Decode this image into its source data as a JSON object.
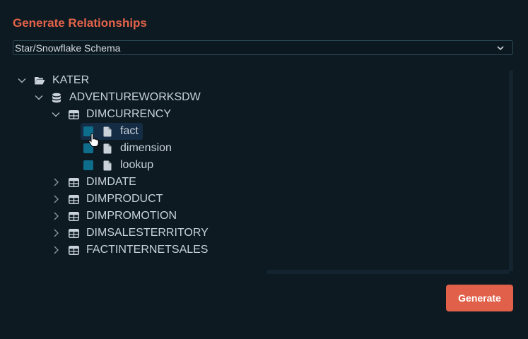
{
  "dialog": {
    "title": "Generate Relationships",
    "schema_select": {
      "value": "Star/Snowflake Schema"
    },
    "generate_label": "Generate"
  },
  "tree": {
    "root": {
      "label": "KATER",
      "icon": "folder-open-icon",
      "expanded": true
    },
    "database": {
      "label": "ADVENTUREWORKSDW",
      "icon": "database-icon",
      "expanded": true
    },
    "tables": [
      {
        "label": "DIMCURRENCY",
        "icon": "table-icon",
        "expanded": true
      },
      {
        "label": "DIMDATE",
        "icon": "table-icon",
        "expanded": false
      },
      {
        "label": "DIMPRODUCT",
        "icon": "table-icon",
        "expanded": false
      },
      {
        "label": "DIMPROMOTION",
        "icon": "table-icon",
        "expanded": false
      },
      {
        "label": "DIMSALESTERRITORY",
        "icon": "table-icon",
        "expanded": false
      },
      {
        "label": "FACTINTERNETSALES",
        "icon": "table-icon",
        "expanded": false
      }
    ],
    "leaves": [
      {
        "label": "fact",
        "icon": "file-icon",
        "selected": true
      },
      {
        "label": "dimension",
        "icon": "file-icon",
        "selected": false
      },
      {
        "label": "lookup",
        "icon": "file-icon",
        "selected": false
      }
    ]
  },
  "colors": {
    "background": "#0d1a22",
    "accent": "#e5634a",
    "checkbox": "#0f6d8c",
    "button": "#e0604a"
  }
}
